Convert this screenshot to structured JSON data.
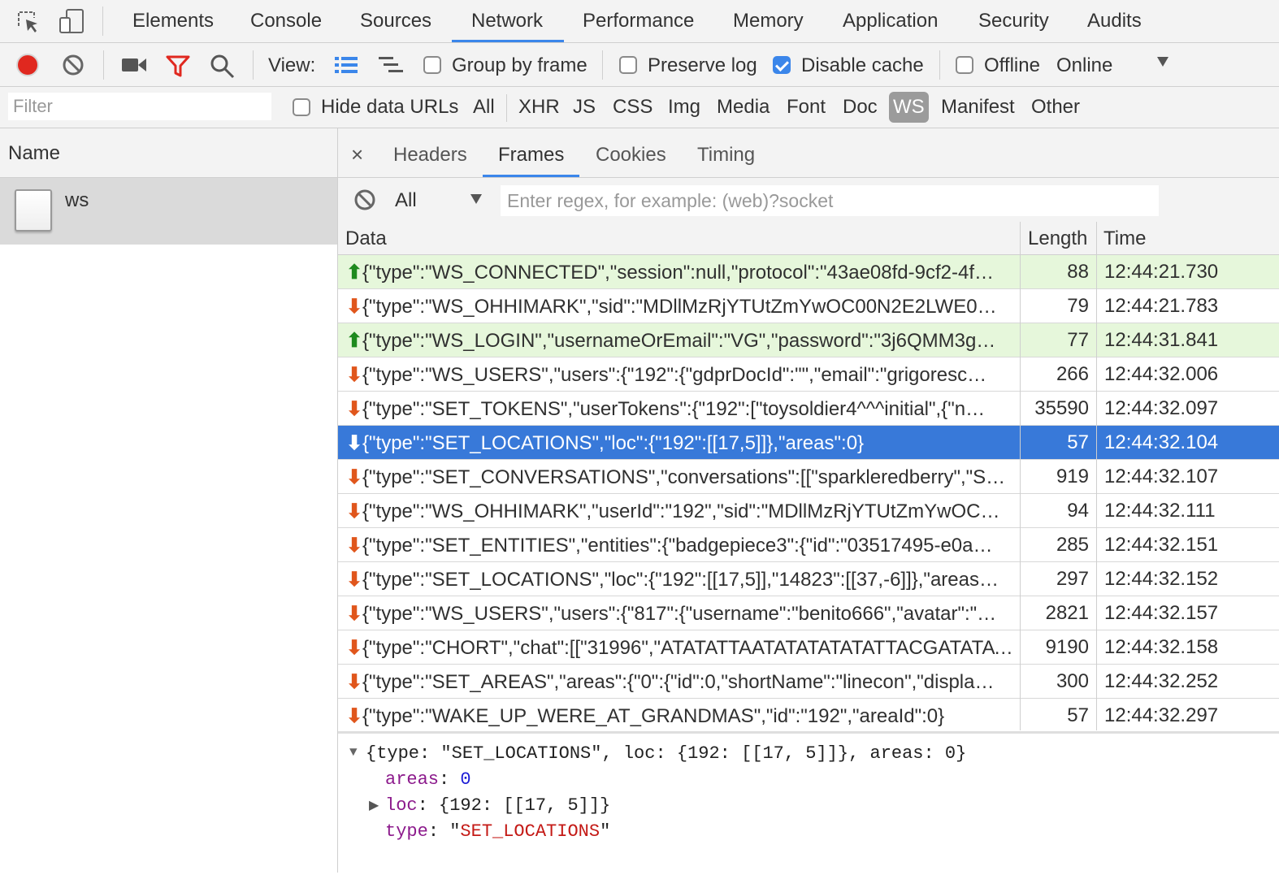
{
  "tabs": [
    "Elements",
    "Console",
    "Sources",
    "Network",
    "Performance",
    "Memory",
    "Application",
    "Security",
    "Audits"
  ],
  "active_tab": "Network",
  "toolbar": {
    "view_label": "View:",
    "group_by_frame": "Group by frame",
    "preserve_log": "Preserve log",
    "disable_cache": "Disable cache",
    "offline": "Offline",
    "throttling": "Online"
  },
  "checkboxes": {
    "group_by_frame": false,
    "preserve_log": false,
    "disable_cache": true,
    "offline": false,
    "hide_data_urls": false
  },
  "filter": {
    "placeholder": "Filter",
    "hide_data_urls": "Hide data URLs",
    "types": [
      "All",
      "XHR",
      "JS",
      "CSS",
      "Img",
      "Media",
      "Font",
      "Doc",
      "WS",
      "Manifest",
      "Other"
    ],
    "active_type": "WS"
  },
  "requests": {
    "column": "Name",
    "items": [
      {
        "name": "ws"
      }
    ]
  },
  "detail": {
    "close": "×",
    "tabs": [
      "Headers",
      "Frames",
      "Cookies",
      "Timing"
    ],
    "active_tab": "Frames",
    "frame_filter": "All",
    "regex_placeholder": "Enter regex, for example: (web)?socket"
  },
  "frames": {
    "columns": [
      "Data",
      "Length",
      "Time"
    ],
    "rows": [
      {
        "dir": "up",
        "data": "{\"type\":\"WS_CONNECTED\",\"session\":null,\"protocol\":\"43ae08fd-9cf2-4f…",
        "length": "88",
        "time": "12:44:21.730"
      },
      {
        "dir": "down",
        "data": "{\"type\":\"WS_OHHIMARK\",\"sid\":\"MDllMzRjYTUtZmYwOC00N2E2LWE0…",
        "length": "79",
        "time": "12:44:21.783"
      },
      {
        "dir": "up",
        "data": "{\"type\":\"WS_LOGIN\",\"usernameOrEmail\":\"VG\",\"password\":\"3j6QMM3g…",
        "length": "77",
        "time": "12:44:31.841"
      },
      {
        "dir": "down",
        "data": "{\"type\":\"WS_USERS\",\"users\":{\"192\":{\"gdprDocId\":\"\",\"email\":\"grigoresc…",
        "length": "266",
        "time": "12:44:32.006"
      },
      {
        "dir": "down",
        "data": "{\"type\":\"SET_TOKENS\",\"userTokens\":{\"192\":[\"toysoldier4^^^initial\",{\"n…",
        "length": "35590",
        "time": "12:44:32.097"
      },
      {
        "dir": "down",
        "data": "{\"type\":\"SET_LOCATIONS\",\"loc\":{\"192\":[[17,5]]},\"areas\":0}",
        "length": "57",
        "time": "12:44:32.104",
        "selected": true
      },
      {
        "dir": "down",
        "data": "{\"type\":\"SET_CONVERSATIONS\",\"conversations\":[[\"sparkleredberry\",\"S…",
        "length": "919",
        "time": "12:44:32.107"
      },
      {
        "dir": "down",
        "data": "{\"type\":\"WS_OHHIMARK\",\"userId\":\"192\",\"sid\":\"MDllMzRjYTUtZmYwOC…",
        "length": "94",
        "time": "12:44:32.111"
      },
      {
        "dir": "down",
        "data": "{\"type\":\"SET_ENTITIES\",\"entities\":{\"badgepiece3\":{\"id\":\"03517495-e0a…",
        "length": "285",
        "time": "12:44:32.151"
      },
      {
        "dir": "down",
        "data": "{\"type\":\"SET_LOCATIONS\",\"loc\":{\"192\":[[17,5]],\"14823\":[[37,-6]]},\"areas…",
        "length": "297",
        "time": "12:44:32.152"
      },
      {
        "dir": "down",
        "data": "{\"type\":\"WS_USERS\",\"users\":{\"817\":{\"username\":\"benito666\",\"avatar\":\"…",
        "length": "2821",
        "time": "12:44:32.157"
      },
      {
        "dir": "down",
        "data": "{\"type\":\"CHORT\",\"chat\":[[\"31996\",\"ATATATTAATATATATATATTACGATATAT…",
        "length": "9190",
        "time": "12:44:32.158"
      },
      {
        "dir": "down",
        "data": "{\"type\":\"SET_AREAS\",\"areas\":{\"0\":{\"id\":0,\"shortName\":\"linecon\",\"displa…",
        "length": "300",
        "time": "12:44:32.252"
      },
      {
        "dir": "down",
        "data": "{\"type\":\"WAKE_UP_WERE_AT_GRANDMAS\",\"id\":\"192\",\"areaId\":0}",
        "length": "57",
        "time": "12:44:32.297"
      }
    ]
  },
  "preview": {
    "summary": "{type: \"SET_LOCATIONS\", loc: {192: [[17, 5]]}, areas: 0}",
    "areas_key": "areas",
    "areas_value": "0",
    "loc_key": "loc",
    "loc_value": "{192: [[17, 5]]}",
    "type_key": "type",
    "type_value": "SET_LOCATIONS"
  },
  "colors": {
    "accent": "#3b86ea",
    "selected_row": "#3879d9",
    "sent_row": "#e6f7db",
    "arrow_up": "#1e8a1e",
    "arrow_down": "#e0561c",
    "record": "#e0281f"
  },
  "icons": [
    "inspect-element-icon",
    "device-toggle-icon",
    "record-icon",
    "clear-icon",
    "screenshot-camera-icon",
    "filter-icon",
    "search-icon",
    "large-rows-icon",
    "waterfall-icon",
    "throttling-dropdown-icon",
    "document-icon",
    "close-icon",
    "block-icon",
    "dropdown-triangle-icon",
    "expand-triangle-icon"
  ]
}
